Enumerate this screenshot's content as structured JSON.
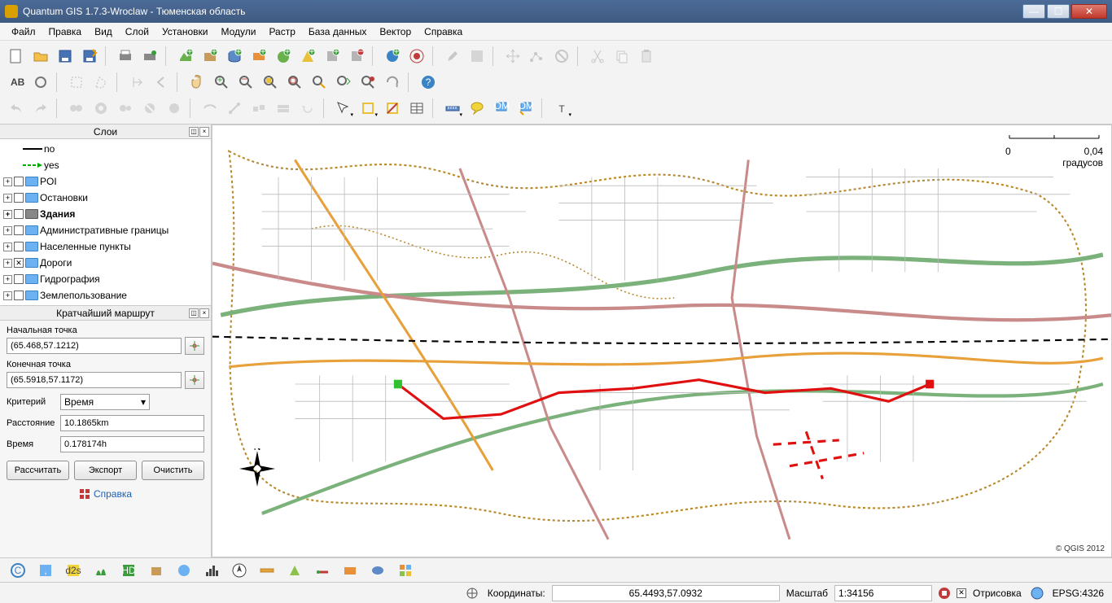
{
  "window": {
    "title": "Quantum GIS 1.7.3-Wroclaw - Тюменская область"
  },
  "menu": [
    "Файл",
    "Правка",
    "Вид",
    "Слой",
    "Установки",
    "Модули",
    "Растр",
    "База данных",
    "Вектор",
    "Справка"
  ],
  "panels": {
    "layers_title": "Слои",
    "route_title": "Кратчайший маршрут"
  },
  "layers": {
    "items": [
      {
        "label": "no",
        "indent": 1,
        "sym": "black-line",
        "folder": false,
        "checked": null,
        "bold": false
      },
      {
        "label": "yes",
        "indent": 1,
        "sym": "green-line",
        "folder": false,
        "checked": null,
        "bold": false
      },
      {
        "label": "POI",
        "indent": 0,
        "folder": true,
        "checked": false,
        "bold": false
      },
      {
        "label": "Остановки",
        "indent": 0,
        "folder": true,
        "checked": false,
        "bold": false
      },
      {
        "label": "Здания",
        "indent": 0,
        "folder": true,
        "checked": false,
        "bold": true,
        "dark": true
      },
      {
        "label": "Административные границы",
        "indent": 0,
        "folder": true,
        "checked": false,
        "bold": false
      },
      {
        "label": "Населенные пункты",
        "indent": 0,
        "folder": true,
        "checked": false,
        "bold": false
      },
      {
        "label": "Дороги",
        "indent": 0,
        "folder": true,
        "checked": true,
        "bold": false
      },
      {
        "label": "Гидрография",
        "indent": 0,
        "folder": true,
        "checked": false,
        "bold": false
      },
      {
        "label": "Землепользование",
        "indent": 0,
        "folder": true,
        "checked": false,
        "bold": false
      }
    ]
  },
  "route": {
    "start_label": "Начальная точка",
    "start_value": "(65.468,57.1212)",
    "end_label": "Конечная точка",
    "end_value": "(65.5918,57.1172)",
    "criterion_label": "Критерий",
    "criterion_value": "Время",
    "distance_label": "Расстояние",
    "distance_value": "10.1865km",
    "time_label": "Время",
    "time_value": "0.178174h",
    "btn_calc": "Рассчитать",
    "btn_export": "Экспорт",
    "btn_clear": "Очистить",
    "help": "Справка"
  },
  "map": {
    "scale_left": "0",
    "scale_right": "0,04",
    "scale_unit": "градусов",
    "copyright": "© QGIS 2012"
  },
  "status": {
    "coords_label": "Координаты:",
    "coords_value": "65.4493,57.0932",
    "scale_label": "Масштаб",
    "scale_value": "1:34156",
    "render_label": "Отрисовка",
    "epsg": "EPSG:4326"
  }
}
